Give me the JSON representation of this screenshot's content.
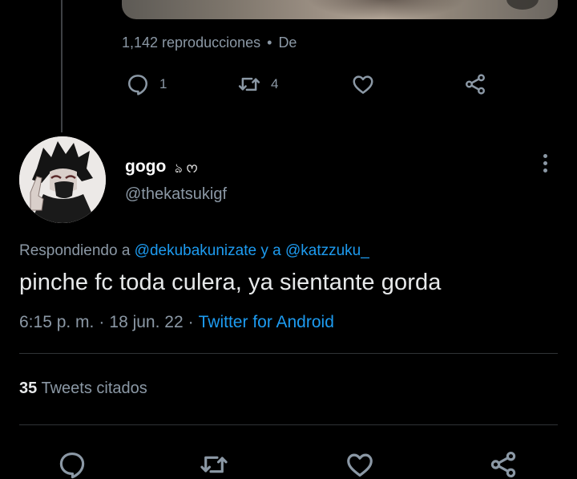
{
  "previous_tweet": {
    "views": "1,142 reproducciones",
    "views_separator": "•",
    "from_label": "De",
    "reply_count": "1",
    "retweet_count": "4"
  },
  "tweet": {
    "display_name": "gogo",
    "name_emoji": "ঌ ᰔ",
    "handle": "@thekatsukigf",
    "replying_prefix": "Respondiendo a",
    "replying_user_1": "@dekubakunizate",
    "replying_connector": "y a",
    "replying_user_2": "@katzzuku_",
    "text": "pinche fc toda culera, ya sientante gorda",
    "time": "6:15 p. m.",
    "sep": "·",
    "date": "18 jun. 22",
    "client": "Twitter for Android",
    "quote_count": "35",
    "quote_label": "Tweets citados"
  },
  "colors": {
    "background": "#000000",
    "primary_text": "#e7e9ea",
    "secondary_text": "#8b98a5",
    "link": "#1d9bf0",
    "divider": "#2f3336"
  },
  "icons": {
    "reply": "reply-icon",
    "retweet": "retweet-icon",
    "like": "heart-icon",
    "share": "share-icon",
    "more": "more-options-icon"
  }
}
